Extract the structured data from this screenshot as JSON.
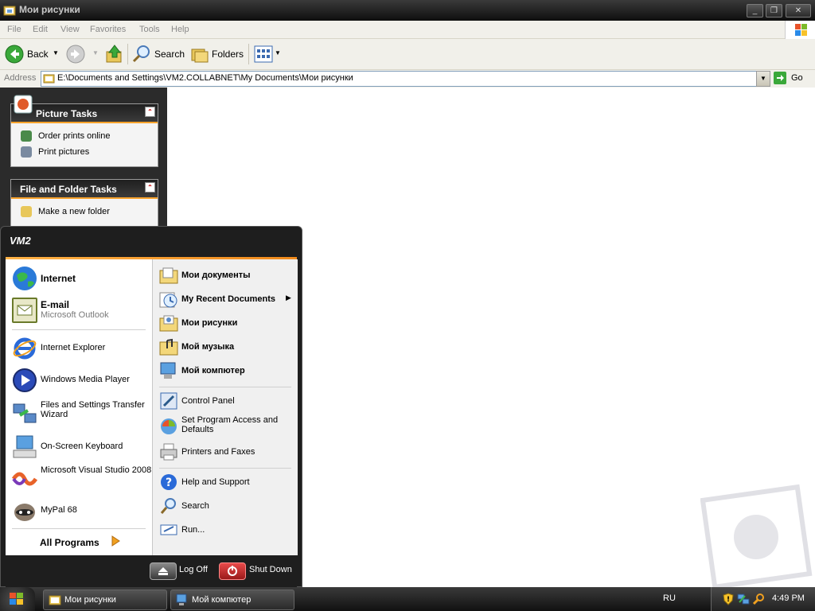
{
  "window": {
    "title": "Мои рисунки",
    "buttons": {
      "minimize": "_",
      "restore": "❐",
      "close": "✕"
    }
  },
  "menubar": [
    "File",
    "Edit",
    "View",
    "Favorites",
    "Tools",
    "Help"
  ],
  "toolbar": {
    "back": "Back",
    "search": "Search",
    "folders": "Folders"
  },
  "address": {
    "label": "Address",
    "value": "E:\\Documents and Settings\\VM2.COLLABNET\\My Documents\\Мои рисунки",
    "go": "Go"
  },
  "taskpane": {
    "picture_tasks": {
      "title": "Picture Tasks",
      "items": [
        "Order prints online",
        "Print pictures"
      ]
    },
    "folder_tasks": {
      "title": "File and Folder Tasks",
      "items": [
        "Make a new folder"
      ]
    }
  },
  "startmenu": {
    "user": "VM2",
    "pinned": [
      {
        "label": "Internet",
        "sub": ""
      },
      {
        "label": "E-mail",
        "sub": "Microsoft Outlook"
      }
    ],
    "recent": [
      "Internet Explorer",
      "Windows Media Player",
      "Files and Settings Transfer Wizard",
      "On-Screen Keyboard",
      "Microsoft Visual Studio 2008",
      "MyPal 68"
    ],
    "all_programs": "All Programs",
    "places": [
      "Мои документы",
      "My Recent Documents",
      "Мои рисунки",
      "Мой музыка",
      "Мой компютер"
    ],
    "settings": [
      "Control Panel",
      "Set Program Access and Defaults",
      "Printers and Faxes"
    ],
    "help": [
      "Help and Support",
      "Search",
      "Run..."
    ],
    "logoff": "Log Off",
    "shutdown": "Shut Down"
  },
  "taskbar": {
    "tasks": [
      "Мои рисунки",
      "Мой компютер"
    ],
    "lang": "RU",
    "clock": "4:49 PM"
  },
  "colors": {
    "accent": "#f7a22b",
    "dark": "#1e1e1e",
    "shutdown": "#c8282a"
  }
}
